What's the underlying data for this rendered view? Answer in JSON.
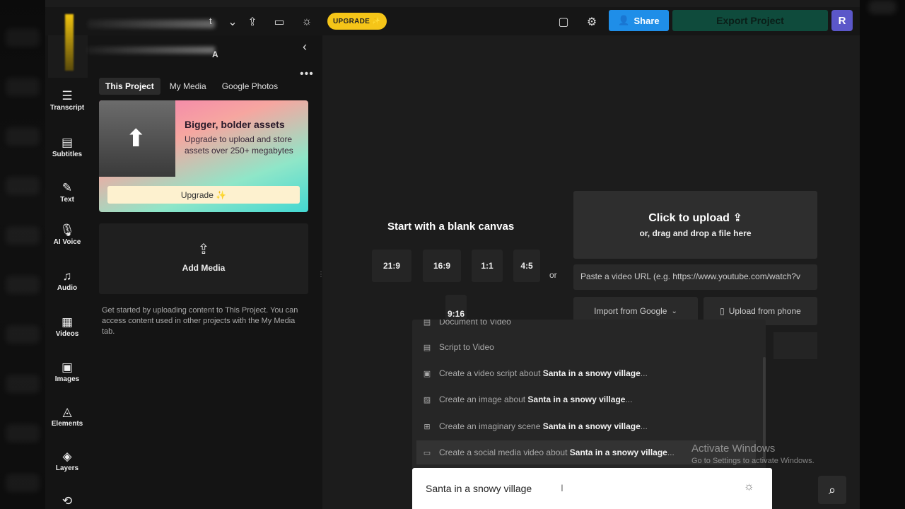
{
  "header": {
    "project_suffix": "t",
    "upgrade_label": "UPGRADE ✨",
    "share_label": "Share",
    "export_label": "Export Project",
    "avatar_initial": "R"
  },
  "sidebar": {
    "brand_suffix": "A",
    "items": [
      {
        "label": "Transcript",
        "icon": "transcript-icon",
        "glyph": "☰"
      },
      {
        "label": "Subtitles",
        "icon": "subtitles-icon",
        "glyph": "▤"
      },
      {
        "label": "Text",
        "icon": "text-icon",
        "glyph": "✎"
      },
      {
        "label": "AI Voice",
        "icon": "ai-voice-icon",
        "glyph": "🎙"
      },
      {
        "label": "Audio",
        "icon": "audio-icon",
        "glyph": "♫"
      },
      {
        "label": "Videos",
        "icon": "videos-icon",
        "glyph": "▦"
      },
      {
        "label": "Images",
        "icon": "images-icon",
        "glyph": "▣"
      },
      {
        "label": "Elements",
        "icon": "elements-icon",
        "glyph": "◬"
      },
      {
        "label": "Layers",
        "icon": "layers-icon",
        "glyph": "◈"
      },
      {
        "label": "",
        "icon": "loop-icon",
        "glyph": "⟲"
      }
    ]
  },
  "media_panel": {
    "tabs": [
      "This Project",
      "My Media",
      "Google Photos"
    ],
    "promo": {
      "title": "Bigger, bolder assets",
      "description": "Upgrade to upload and store assets over 250+ megabytes",
      "button": "Upgrade ✨"
    },
    "add_media_label": "Add Media",
    "help_text": "Get started by uploading content to This Project. You can access content used in other projects with the My Media tab."
  },
  "canvas": {
    "blank_title": "Start with a blank canvas",
    "ratios": [
      "21:9",
      "16:9",
      "1:1",
      "4:5",
      "9:16"
    ],
    "or_label": "or",
    "upload_title": "Click to upload",
    "upload_sub": "or, drag and drop a file here",
    "url_placeholder": "Paste a video URL (e.g. https://www.youtube.com/watch?v",
    "import_google": "Import from Google",
    "upload_phone": "Upload from phone"
  },
  "suggestions": {
    "partial_item": "Document to Video",
    "items": [
      {
        "prefix": "Script to Video",
        "topic": "",
        "suffix": ""
      },
      {
        "prefix": "Create a video script about ",
        "topic": "Santa in a snowy village",
        "suffix": "..."
      },
      {
        "prefix": "Create an image about ",
        "topic": "Santa in a snowy village",
        "suffix": "..."
      },
      {
        "prefix": "Create an imaginary scene ",
        "topic": "Santa in a snowy village",
        "suffix": "..."
      },
      {
        "prefix": "Create a social media video about ",
        "topic": "Santa in a snowy village",
        "suffix": "..."
      }
    ]
  },
  "search": {
    "value": "Santa in a snowy village"
  },
  "watermark": {
    "line1": "Activate Windows",
    "line2": "Go to Settings to activate Windows."
  }
}
